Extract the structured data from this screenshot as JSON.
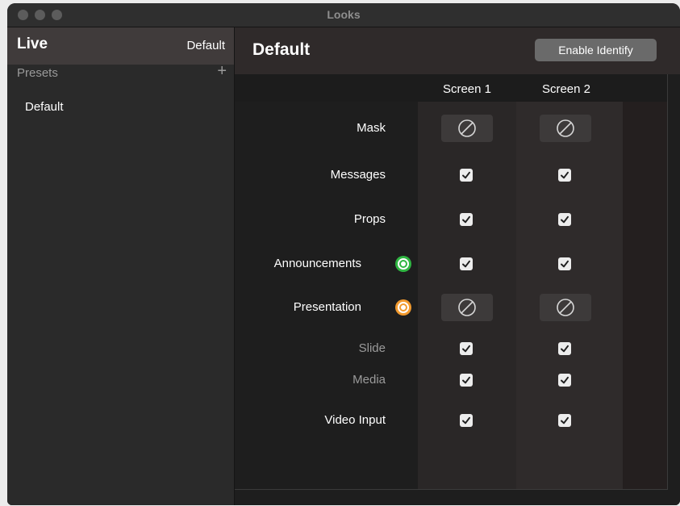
{
  "window": {
    "title": "Looks"
  },
  "sidebar": {
    "live_label": "Live",
    "live_value": "Default",
    "presets_label": "Presets",
    "add_button": "+",
    "items": [
      {
        "label": "Default"
      }
    ]
  },
  "main": {
    "title": "Default",
    "identify_button": "Enable Identify",
    "columns": [
      "Screen 1",
      "Screen 2"
    ],
    "rows": [
      {
        "label": "Mask",
        "status": null,
        "screen1": "none",
        "screen2": "none"
      },
      {
        "label": "Messages",
        "status": null,
        "screen1": "checked",
        "screen2": "checked"
      },
      {
        "label": "Props",
        "status": null,
        "screen1": "checked",
        "screen2": "checked"
      },
      {
        "label": "Announcements",
        "status": "live-green",
        "screen1": "checked",
        "screen2": "checked"
      },
      {
        "label": "Presentation",
        "status": "live-orange",
        "screen1": "none",
        "screen2": "none"
      },
      {
        "label": "Slide",
        "status": null,
        "screen1": "checked",
        "screen2": "checked"
      },
      {
        "label": "Media",
        "status": null,
        "screen1": "checked",
        "screen2": "checked"
      },
      {
        "label": "Video Input",
        "status": null,
        "screen1": "checked",
        "screen2": "checked"
      }
    ]
  },
  "colors": {
    "status_green": "#2fb642",
    "status_orange": "#f29a2e",
    "live_row_bg": "#403b3b"
  }
}
